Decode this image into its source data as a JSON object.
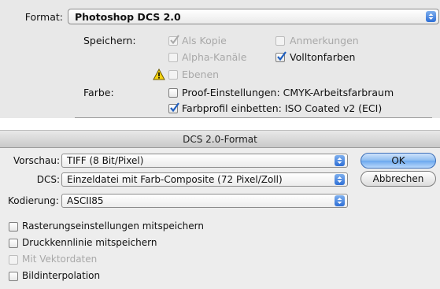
{
  "top": {
    "format_label": "Format:",
    "format_value": "Photoshop DCS 2.0",
    "save_label": "Speichern:",
    "options": {
      "als_kopie": {
        "label": "Als Kopie",
        "checked": true,
        "enabled": false
      },
      "anmerkungen": {
        "label": "Anmerkungen",
        "checked": false,
        "enabled": false
      },
      "alpha_kanaele": {
        "label": "Alpha-Kanäle",
        "checked": false,
        "enabled": false
      },
      "volltonfarben": {
        "label": "Volltonfarben",
        "checked": true,
        "enabled": true
      },
      "ebenen": {
        "label": "Ebenen",
        "checked": false,
        "enabled": false
      }
    },
    "color_label": "Farbe:",
    "proof": {
      "label": "Proof-Einstellungen: CMYK-Arbeitsfarbraum",
      "checked": false
    },
    "profile": {
      "label": "Farbprofil einbetten: ISO Coated v2 (ECI)",
      "checked": true
    },
    "warning_icon": "warning-icon"
  },
  "dialog": {
    "title": "DCS 2.0-Format",
    "preview_label": "Vorschau:",
    "preview_value": "TIFF (8 Bit/Pixel)",
    "dcs_label": "DCS:",
    "dcs_value": "Einzeldatei mit Farb-Composite (72 Pixel/Zoll)",
    "encoding_label": "Kodierung:",
    "encoding_value": "ASCII85",
    "ok_label": "OK",
    "cancel_label": "Abbrechen",
    "checkboxes": [
      {
        "label": "Rasterungseinstellungen mitspeichern",
        "checked": false,
        "enabled": true
      },
      {
        "label": "Druckkennlinie mitspeichern",
        "checked": false,
        "enabled": true
      },
      {
        "label": "Mit Vektordaten",
        "checked": false,
        "enabled": false
      },
      {
        "label": "Bildinterpolation",
        "checked": false,
        "enabled": true
      }
    ]
  }
}
